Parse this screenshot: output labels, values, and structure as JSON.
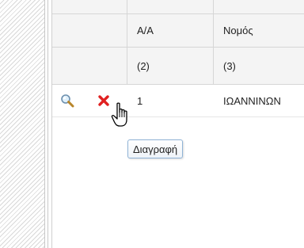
{
  "grid": {
    "columns": [
      {
        "header": "A/A",
        "number": "(2)"
      },
      {
        "header": "Νομός",
        "number": "(3)"
      }
    ],
    "rows": [
      {
        "aa": "1",
        "nomos": "ΙΩΑΝΝΙΝΩΝ"
      }
    ]
  },
  "actions": {
    "view_icon": "magnifier-icon",
    "delete_icon": "delete-x-icon"
  },
  "tooltip": {
    "text": "Διαγραφή"
  },
  "cursor": {
    "icon": "hand-pointer-icon"
  },
  "colors": {
    "delete": "#e02020",
    "tooltip_border": "#8fb3d6",
    "header_bg": "#f4f4f4"
  }
}
